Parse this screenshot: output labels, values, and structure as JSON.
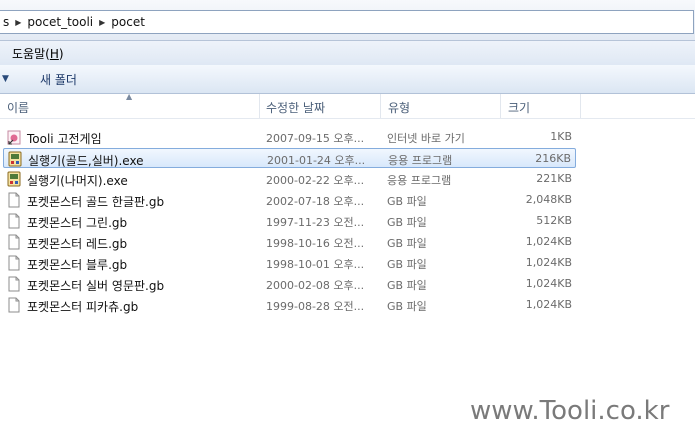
{
  "address": {
    "crumbs": [
      "s",
      "pocet_tooli",
      "pocet"
    ]
  },
  "menu": {
    "help_label": "도움말(",
    "help_key": "H",
    "help_tail": ")"
  },
  "command_bar": {
    "new_folder": "새 폴더"
  },
  "columns": {
    "name": "이름",
    "date": "수정한 날짜",
    "type": "유형",
    "size": "크기"
  },
  "files": [
    {
      "name": "Tooli 고전게임",
      "date": "2007-09-15 오후...",
      "type": "인터넷 바로 가기",
      "size": "1KB",
      "icon": "internet-shortcut-icon"
    },
    {
      "name": "실행기(골드,실버).exe",
      "date": "2001-01-24 오후...",
      "type": "응용 프로그램",
      "size": "216KB",
      "icon": "application-icon"
    },
    {
      "name": "실행기(나머지).exe",
      "date": "2000-02-22 오후...",
      "type": "응용 프로그램",
      "size": "221KB",
      "icon": "application-icon"
    },
    {
      "name": "포켓몬스터 골드 한글판.gb",
      "date": "2002-07-18 오후...",
      "type": "GB 파일",
      "size": "2,048KB",
      "icon": "file-icon"
    },
    {
      "name": "포켓몬스터 그린.gb",
      "date": "1997-11-23 오전...",
      "type": "GB 파일",
      "size": "512KB",
      "icon": "file-icon"
    },
    {
      "name": "포켓몬스터 레드.gb",
      "date": "1998-10-16 오전...",
      "type": "GB 파일",
      "size": "1,024KB",
      "icon": "file-icon"
    },
    {
      "name": "포켓몬스터 블루.gb",
      "date": "1998-10-01 오후...",
      "type": "GB 파일",
      "size": "1,024KB",
      "icon": "file-icon"
    },
    {
      "name": "포켓몬스터 실버 영문판.gb",
      "date": "2000-02-08 오후...",
      "type": "GB 파일",
      "size": "1,024KB",
      "icon": "file-icon"
    },
    {
      "name": "포켓몬스터 피카츄.gb",
      "date": "1999-08-28 오전...",
      "type": "GB 파일",
      "size": "1,024KB",
      "icon": "file-icon"
    }
  ],
  "selected_index": 1,
  "watermark": "www.Tooli.co.kr",
  "colors": {
    "selection_border": "#84acdd",
    "header_text": "#4c607a",
    "detail_text": "#6b6b6b"
  }
}
